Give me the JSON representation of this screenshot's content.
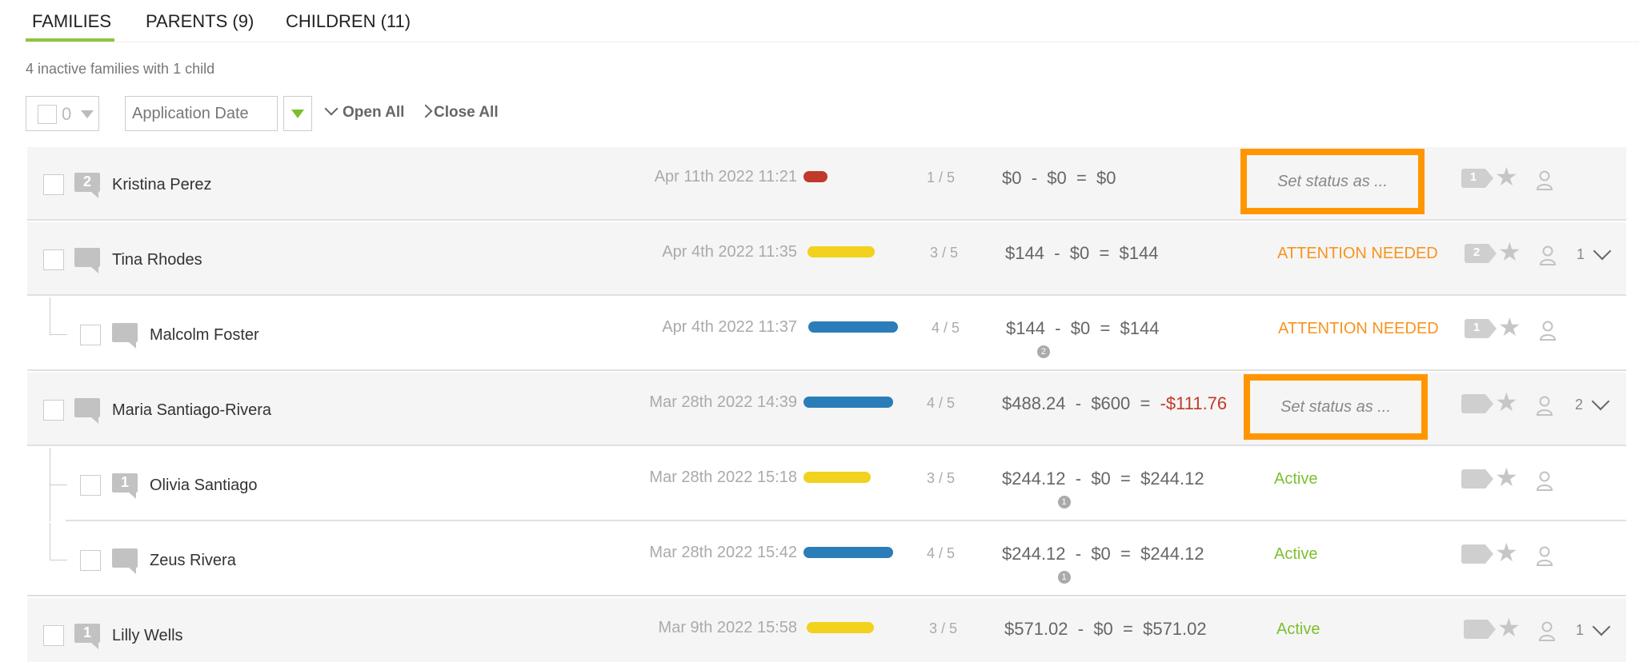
{
  "tabs": [
    {
      "label": "FAMILIES"
    },
    {
      "label": "PARENTS (9)"
    },
    {
      "label": "CHILDREN (11)"
    }
  ],
  "summary": "4 inactive families with 1 child",
  "toolbar": {
    "selected_count": "0",
    "sort_field": "Application Date",
    "open_all": "Open All",
    "close_all": "Close All"
  },
  "colors": {
    "accent": "#8dc63f",
    "attention": "#f7941d",
    "active": "#7cbf2e",
    "negative": "#c0392b",
    "highlight_box": "#ff9600",
    "bar_red": "#c0392b",
    "bar_yellow": "#f2d21d",
    "bar_blue": "#2a7db8"
  },
  "rows": [
    {
      "name": "Kristina Perez",
      "badge": "2",
      "date": "Apr 11th 2022 11:21",
      "bar_color": "red",
      "score": "1 / 5",
      "amount": {
        "a": "$0",
        "b": "$0",
        "c": "$0",
        "note": ""
      },
      "status": "Set status as ...",
      "tag_count": "1",
      "expand": ""
    },
    {
      "name": "Tina Rhodes",
      "badge": "",
      "date": "Apr 4th 2022 11:35",
      "bar_color": "yellow",
      "score": "3 / 5",
      "amount": {
        "a": "$144",
        "b": "$0",
        "c": "$144",
        "note": ""
      },
      "status": "ATTENTION NEEDED",
      "tag_count": "2",
      "expand": "1"
    },
    {
      "name": "Malcolm Foster",
      "badge": "",
      "date": "Apr 4th 2022 11:37",
      "bar_color": "blue",
      "score": "4 / 5",
      "amount": {
        "a": "$144",
        "b": "$0",
        "c": "$144",
        "note": "2"
      },
      "status": "ATTENTION NEEDED",
      "tag_count": "1",
      "expand": ""
    },
    {
      "name": "Maria Santiago-Rivera",
      "badge": "",
      "date": "Mar 28th 2022 14:39",
      "bar_color": "blue",
      "score": "4 / 5",
      "amount": {
        "a": "$488.24",
        "b": "$600",
        "c": "-$111.76",
        "note": ""
      },
      "status": "Set status as ...",
      "tag_count": "",
      "expand": "2"
    },
    {
      "name": "Olivia Santiago",
      "badge": "1",
      "date": "Mar 28th 2022 15:18",
      "bar_color": "yellow",
      "score": "3 / 5",
      "amount": {
        "a": "$244.12",
        "b": "$0",
        "c": "$244.12",
        "note": "1"
      },
      "status": "Active",
      "tag_count": "",
      "expand": ""
    },
    {
      "name": "Zeus Rivera",
      "badge": "",
      "date": "Mar 28th 2022 15:42",
      "bar_color": "blue",
      "score": "4 / 5",
      "amount": {
        "a": "$244.12",
        "b": "$0",
        "c": "$244.12",
        "note": "1"
      },
      "status": "Active",
      "tag_count": "",
      "expand": ""
    },
    {
      "name": "Lilly Wells",
      "badge": "1",
      "date": "Mar 9th 2022 15:58",
      "bar_color": "yellow",
      "score": "3 / 5",
      "amount": {
        "a": "$571.02",
        "b": "$0",
        "c": "$571.02",
        "note": ""
      },
      "status": "Active",
      "tag_count": "",
      "expand": "1"
    }
  ],
  "icons": {
    "row_badge": "comment-bubble-icon",
    "tag": "tag-icon",
    "star": "star-icon",
    "assign": "user-icon",
    "expand": "chevron-down-icon"
  }
}
